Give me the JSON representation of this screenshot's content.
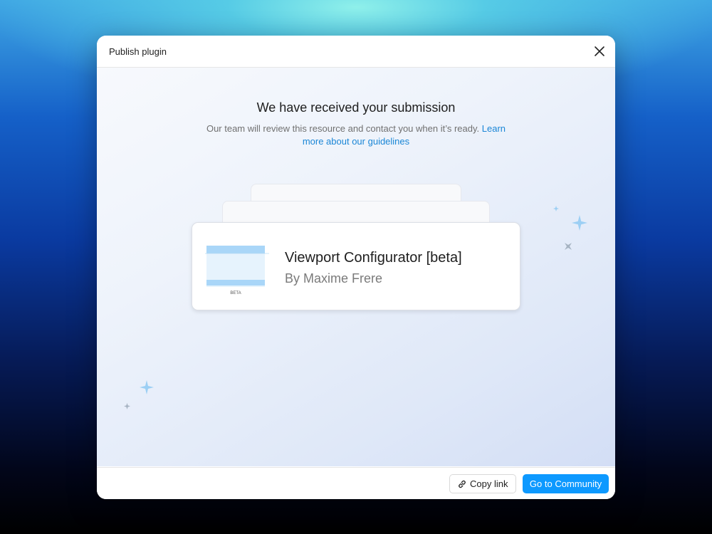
{
  "modal": {
    "title": "Publish plugin",
    "heading": "We have received your submission",
    "message": "Our team will review this resource and contact you when it’s ready.",
    "learn_more_link": "Learn more about our guidelines"
  },
  "plugin_card": {
    "name": "Viewport Configurator [beta]",
    "author": "By Maxime Frere",
    "thumbnail_badge": "BETA"
  },
  "footer": {
    "copy_link_label": "Copy link",
    "primary_label": "Go to Community"
  },
  "colors": {
    "primary_button": "#0d99ff",
    "link": "#1a86d6",
    "thumbnail_bar": "#a9d6f8",
    "thumbnail_fill": "#e6f3fd",
    "sparkle_blue": "#9ccff4",
    "sparkle_gray": "#a6b3c2"
  },
  "icons": [
    "close-icon",
    "link-icon",
    "sparkle-icon"
  ]
}
